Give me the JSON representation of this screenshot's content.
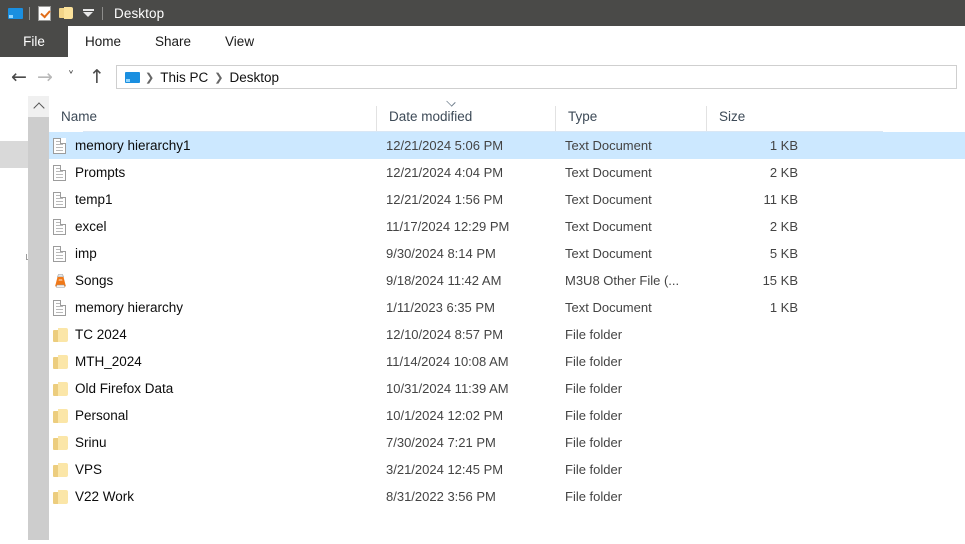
{
  "window": {
    "title": "Desktop",
    "titlebar_bg": "#4a4a48",
    "quick_access": [
      {
        "name": "this-pc-icon",
        "label": "This PC"
      },
      {
        "name": "properties-icon",
        "label": "Properties"
      },
      {
        "name": "new-folder-icon",
        "label": "New folder"
      },
      {
        "name": "customize-quick-access-icon",
        "label": "Customize Quick Access Toolbar"
      }
    ]
  },
  "ribbon": {
    "file_tab": "File",
    "tabs": [
      {
        "label": "Home",
        "active": true
      },
      {
        "label": "Share",
        "active": false
      },
      {
        "label": "View",
        "active": false
      }
    ]
  },
  "navigation": {
    "back": "Back",
    "forward": "Forward",
    "recent": "Recent locations",
    "up": "Up",
    "breadcrumb": [
      {
        "label": "This PC",
        "icon": "this-pc-icon"
      },
      {
        "label": "Desktop",
        "icon": ""
      }
    ]
  },
  "nav_pane": {
    "items": [
      {
        "icon": "quick-access-star-icon",
        "selected": false
      },
      {
        "icon": "desktop-monitor-icon",
        "selected": true
      },
      {
        "icon": "folder-icon",
        "selected": false
      },
      {
        "icon": "downloads-arrow-icon",
        "selected": false
      },
      {
        "icon": "folder-icon",
        "selected": false
      },
      {
        "icon": "documents-icon",
        "selected": false
      },
      {
        "icon": "folder-icon",
        "selected": false
      },
      {
        "icon": "folder-icon",
        "selected": false
      },
      {
        "icon": "pictures-icon",
        "selected": false
      },
      {
        "icon": "folder-icon",
        "selected": false
      },
      {
        "icon": "folder-icon",
        "selected": false
      },
      {
        "icon": "folder-icon",
        "selected": false
      },
      {
        "icon": "folder-icon",
        "selected": false
      },
      {
        "icon": "folder-icon",
        "selected": false
      }
    ]
  },
  "file_list": {
    "columns": [
      {
        "key": "name",
        "label": "Name",
        "sorted": false
      },
      {
        "key": "date",
        "label": "Date modified",
        "sorted": true,
        "sort_direction": "descending"
      },
      {
        "key": "type",
        "label": "Type",
        "sorted": false
      },
      {
        "key": "size",
        "label": "Size",
        "sorted": false
      }
    ],
    "selection_color": "#cce8ff",
    "rows": [
      {
        "name": "memory hierarchy1",
        "date": "12/21/2024 5:06 PM",
        "type": "Text Document",
        "size": "1 KB",
        "icon": "text-document-icon",
        "selected": true
      },
      {
        "name": "Prompts",
        "date": "12/21/2024 4:04 PM",
        "type": "Text Document",
        "size": "2 KB",
        "icon": "text-document-icon",
        "selected": false
      },
      {
        "name": "temp1",
        "date": "12/21/2024 1:56 PM",
        "type": "Text Document",
        "size": "11 KB",
        "icon": "text-document-icon",
        "selected": false
      },
      {
        "name": "excel",
        "date": "11/17/2024 12:29 PM",
        "type": "Text Document",
        "size": "2 KB",
        "icon": "text-document-icon",
        "selected": false
      },
      {
        "name": "imp",
        "date": "9/30/2024 8:14 PM",
        "type": "Text Document",
        "size": "5 KB",
        "icon": "text-document-icon",
        "selected": false
      },
      {
        "name": "Songs",
        "date": "9/18/2024 11:42 AM",
        "type": "M3U8 Other File (...",
        "size": "15 KB",
        "icon": "vlc-media-icon",
        "selected": false
      },
      {
        "name": "memory hierarchy",
        "date": "1/11/2023 6:35 PM",
        "type": "Text Document",
        "size": "1 KB",
        "icon": "text-document-icon",
        "selected": false
      },
      {
        "name": "TC 2024",
        "date": "12/10/2024 8:57 PM",
        "type": "File folder",
        "size": "",
        "icon": "folder-icon",
        "selected": false
      },
      {
        "name": "MTH_2024",
        "date": "11/14/2024 10:08 AM",
        "type": "File folder",
        "size": "",
        "icon": "folder-icon",
        "selected": false
      },
      {
        "name": "Old Firefox Data",
        "date": "10/31/2024 11:39 AM",
        "type": "File folder",
        "size": "",
        "icon": "folder-icon",
        "selected": false
      },
      {
        "name": "Personal",
        "date": "10/1/2024 12:02 PM",
        "type": "File folder",
        "size": "",
        "icon": "folder-icon",
        "selected": false
      },
      {
        "name": "Srinu",
        "date": "7/30/2024 7:21 PM",
        "type": "File folder",
        "size": "",
        "icon": "folder-icon",
        "selected": false
      },
      {
        "name": "VPS",
        "date": "3/21/2024 12:45 PM",
        "type": "File folder",
        "size": "",
        "icon": "folder-icon",
        "selected": false
      },
      {
        "name": "V22 Work",
        "date": "8/31/2022 3:56 PM",
        "type": "File folder",
        "size": "",
        "icon": "folder-icon",
        "selected": false
      }
    ]
  }
}
